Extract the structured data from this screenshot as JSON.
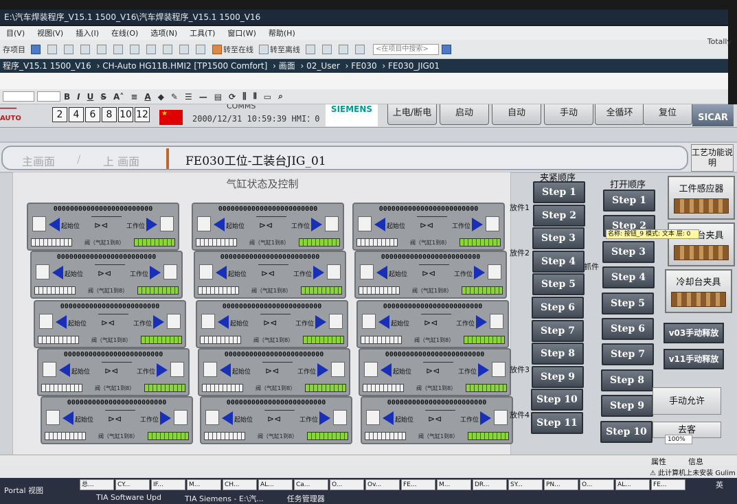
{
  "window": {
    "title": "E:\\汽车焊装程序_V15.1  1500_V16\\汽车焊装程序_V15.1  1500_V16"
  },
  "menu": [
    "目(V)",
    "视图(V)",
    "插入(I)",
    "在线(O)",
    "选项(N)",
    "工具(T)",
    "窗口(W)",
    "帮助(H)"
  ],
  "toolbar": {
    "save_project": "存项目",
    "go_online": "转至在线",
    "go_offline": "转至离线",
    "search_placeholder": "<在项目中搜索>",
    "right_text": "Totally"
  },
  "breadcrumb": [
    "程序_V15.1  1500_V16",
    "CH-Auto HG11B.HMI2 [TP1500 Comfort]",
    "画面",
    "02_User",
    "FE030",
    "FE030_JIG01"
  ],
  "hmi": {
    "number_buttons": [
      "2",
      "4",
      "6",
      "8",
      "10",
      "12"
    ],
    "datetime": "2000/12/31  10:59:39",
    "hmi_status": "HMI：0",
    "comm_label": "COMMS",
    "brand": "SIEMENS",
    "header_buttons": [
      "上电/断电",
      "启动",
      "自动",
      "手动",
      "全循环",
      "复位"
    ],
    "sicar": "SICAR"
  },
  "nav": {
    "main_screen": "主画面",
    "prev_screen": "上 画面",
    "title": "FE030工位-工装台JIG_01",
    "process_button": "工艺功能说明"
  },
  "cylinders": {
    "title": "气缸状态及控制",
    "card_name": "000000000000000000000000",
    "start_label": "起始位",
    "work_label": "工作位",
    "valve_label": "阀（气缸1到8）",
    "card_count": 15
  },
  "clamp": {
    "header": "夹紧顺序",
    "steps": [
      "Step 1",
      "Step 2",
      "Step 3",
      "Step 4",
      "Step 5",
      "Step 6",
      "Step 7",
      "Step 8",
      "Step 9",
      "Step 10",
      "Step 11"
    ]
  },
  "open": {
    "header": "打开顺序",
    "steps": [
      "Step 1",
      "Step 2",
      "Step 3",
      "Step 4",
      "Step 5",
      "Step 6",
      "Step 7",
      "Step 8",
      "Step 9",
      "Step 10"
    ]
  },
  "side_labels": [
    "放件1",
    "放件2",
    "抓件",
    "放件3",
    "放件4"
  ],
  "tooltip": "名称: 按钮_9  模式: 文本  层: 0",
  "functions": {
    "workpiece_sensor": "工件感应器",
    "workbench_fixture": "工件台夹具",
    "cooling_fixture": "冷却台夹具",
    "v03_release": "v03手动释放",
    "v11_release": "v11手动释放",
    "manual_allow": "手动允许",
    "bottom_partial": "去客"
  },
  "zoom": "100%",
  "status": {
    "properties": "属性",
    "info": "信息",
    "warning": "此计算机上未安装 Gulim"
  },
  "taskbar": {
    "portal": "Portal 视图",
    "tasks": [
      "总...",
      "CY...",
      "IF...",
      "M...",
      "CH...",
      "AL...",
      "Ca...",
      "O...",
      "Ov...",
      "FE...",
      "M...",
      "DR...",
      "SY...",
      "PN...",
      "O...",
      "AL...",
      "FE..."
    ],
    "apps": [
      "TIA  Software Upd",
      "TIA  Siemens - E:\\汽...",
      "任务管理器"
    ],
    "tray": "英"
  }
}
